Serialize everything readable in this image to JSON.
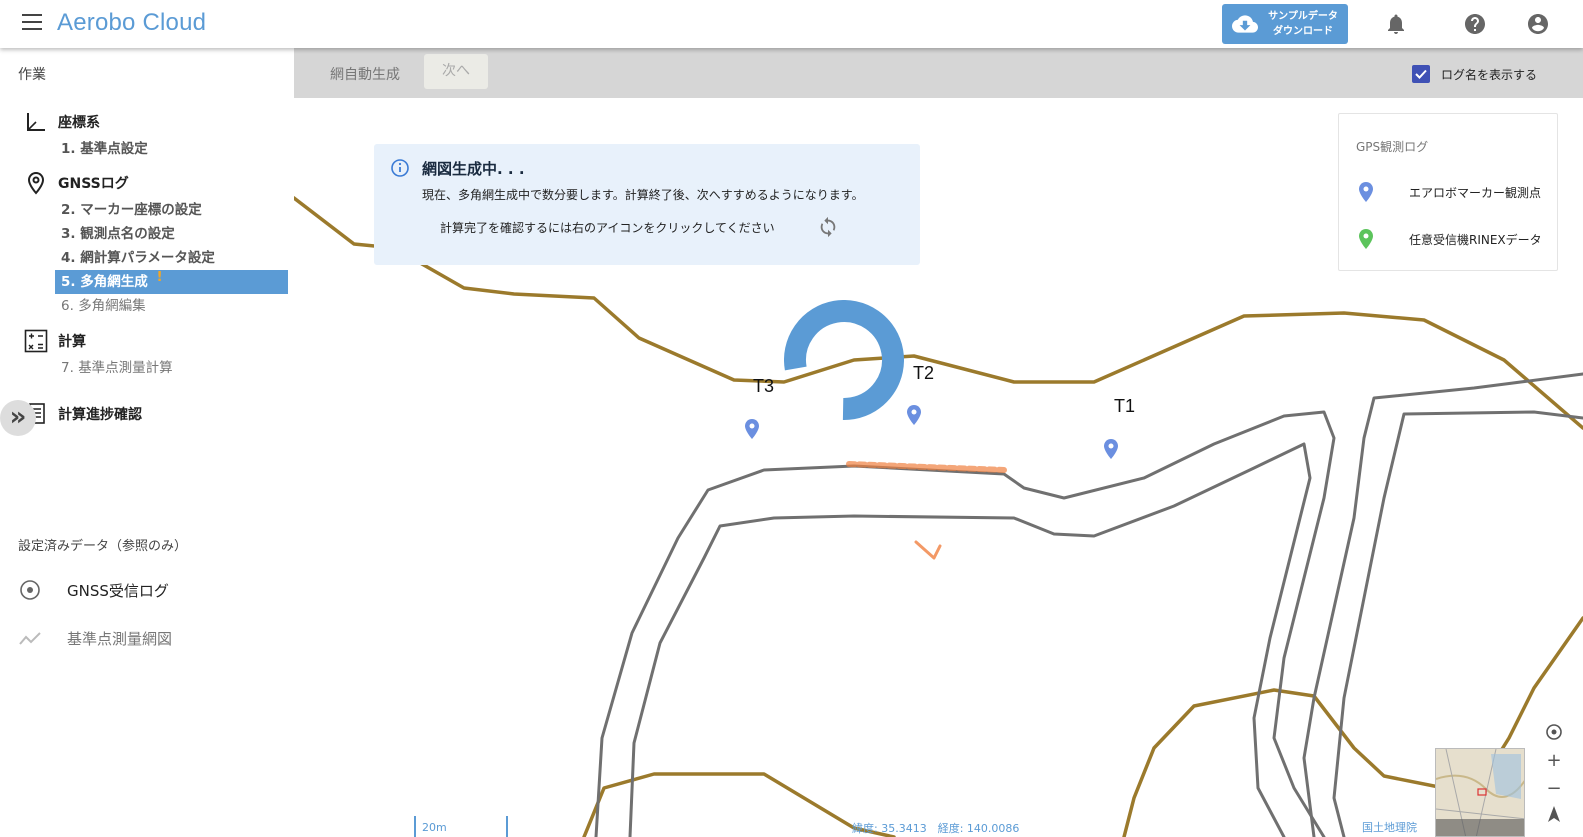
{
  "header": {
    "app_title": "Aerobo Cloud",
    "download_line1": "サンプルデータ",
    "download_line2": "ダウンロード"
  },
  "sidebar": {
    "section_title": "作業",
    "groups": [
      {
        "label": "座標系",
        "icon": "axis-icon"
      },
      {
        "label": "GNSSログ",
        "icon": "location-pin-icon"
      },
      {
        "label": "計算",
        "icon": "calculator-icon"
      },
      {
        "label": "計算進捗確認",
        "icon": "list-icon"
      }
    ],
    "steps": [
      {
        "num": "1.",
        "label": "基準点設定"
      },
      {
        "num": "2.",
        "label": "マーカー座標の設定"
      },
      {
        "num": "3.",
        "label": "観測点名の設定"
      },
      {
        "num": "4.",
        "label": "網計算パラメータ設定"
      },
      {
        "num": "5.",
        "label": "多角網生成",
        "warning": "!"
      },
      {
        "num": "6.",
        "label": "多角網編集"
      },
      {
        "num": "7.",
        "label": "基準点測量計算"
      }
    ],
    "reference_title": "設定済みデータ（参照のみ）",
    "reference_items": [
      {
        "label": "GNSS受信ログ",
        "icon": "target-icon"
      },
      {
        "label": "基準点測量網図",
        "icon": "trend-line-icon"
      }
    ]
  },
  "toolbar": {
    "auto_generate": "網自動生成",
    "next": "次へ",
    "show_log_names": "ログ名を表示する",
    "show_log_names_checked": true
  },
  "info": {
    "title": "網図生成中. . .",
    "message": "現在、多角網生成中で数分要します。計算終了後、次へすすめるようになります。",
    "hint": "計算完了を確認するには右のアイコンをクリックしてください"
  },
  "legend": {
    "title": "GPS観測ログ",
    "items": [
      {
        "label": "エアロボマーカー観測点",
        "color": "#6b8fe0"
      },
      {
        "label": "任意受信機RINEXデータ",
        "color": "#5cc45c"
      }
    ]
  },
  "points": [
    {
      "label": "T3"
    },
    {
      "label": "T2"
    },
    {
      "label": "T1"
    }
  ],
  "map_footer": {
    "scale": "20m",
    "coords": "緯度: 35.3413　経度: 140.0086",
    "attribution": "国土地理院"
  },
  "colors": {
    "accent": "#5b9bd5",
    "road_brown": "#9b7a2c",
    "road_gray": "#707070"
  }
}
